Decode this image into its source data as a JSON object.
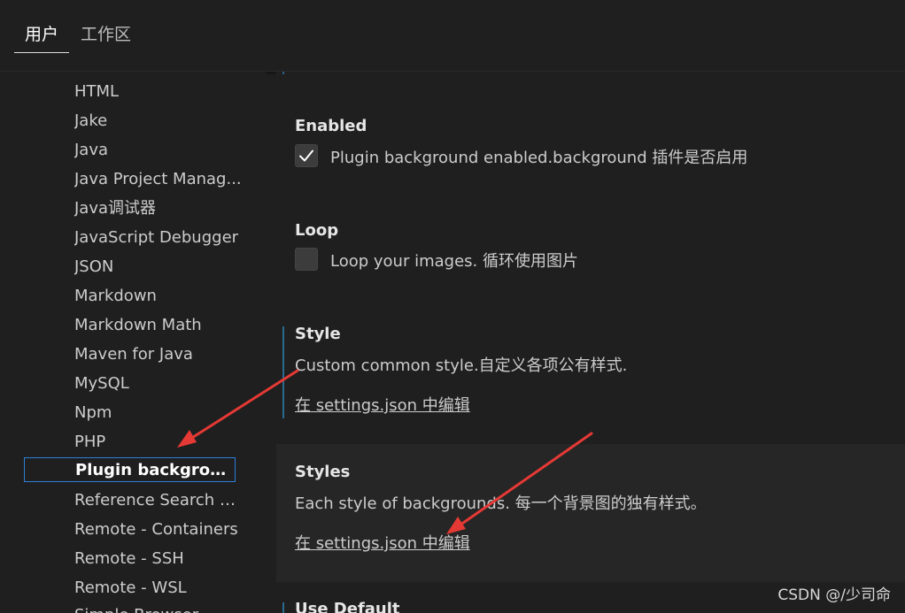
{
  "tabs": {
    "user": "用户",
    "workspace": "工作区"
  },
  "sidebar": {
    "items": [
      {
        "label": "HTML"
      },
      {
        "label": "Jake"
      },
      {
        "label": "Java"
      },
      {
        "label": "Java Project Manag..."
      },
      {
        "label": "Java调试器"
      },
      {
        "label": "JavaScript Debugger"
      },
      {
        "label": "JSON"
      },
      {
        "label": "Markdown"
      },
      {
        "label": "Markdown Math"
      },
      {
        "label": "Maven for Java"
      },
      {
        "label": "MySQL"
      },
      {
        "label": "Npm"
      },
      {
        "label": "PHP"
      },
      {
        "label": "Plugin backgroun...",
        "active": true
      },
      {
        "label": "Reference Search V..."
      },
      {
        "label": "Remote - Containers"
      },
      {
        "label": "Remote - SSH"
      },
      {
        "label": "Remote - WSL"
      },
      {
        "label": "Simple Browser"
      }
    ]
  },
  "settings": {
    "enabled": {
      "title": "Enabled",
      "description": "Plugin background enabled.background 插件是否启用",
      "checked": true
    },
    "loop": {
      "title": "Loop",
      "description": "Loop your images. 循环使用图片",
      "checked": false
    },
    "style": {
      "title": "Style",
      "description": "Custom common style.自定义各项公有样式.",
      "edit_link": "在 settings.json 中编辑"
    },
    "styles": {
      "title": "Styles",
      "description": "Each style of backgrounds. 每一个背景图的独有样式。",
      "edit_link": "在 settings.json 中编辑"
    },
    "use_default": {
      "title": "Use Default"
    }
  },
  "watermark": "CSDN @/少司命",
  "colors": {
    "background": "#1f1f1f",
    "active_border": "#2e7fd8",
    "annotation_arrow": "#e53935",
    "modified_bar": "#2b6a8f"
  }
}
